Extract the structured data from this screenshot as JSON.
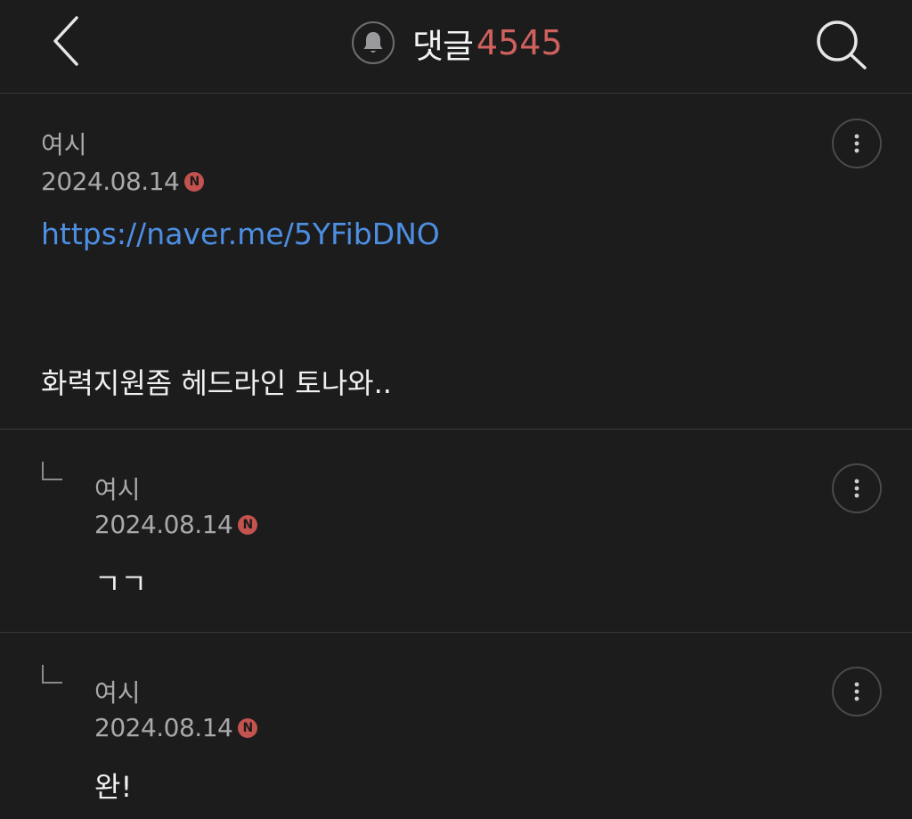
{
  "header": {
    "back_icon": "chevron-left-icon",
    "bell_icon": "bell-icon",
    "title": "댓글",
    "count": "4545",
    "search_icon": "search-icon",
    "accent_color": "#d0615d"
  },
  "comments": [
    {
      "author": "여시",
      "date": "2024.08.14",
      "new_badge": "N",
      "link": "https://naver.me/5YFibDNO",
      "text": "화력지원좀 헤드라인 토나와..",
      "more_icon": "more-vertical-icon"
    },
    {
      "author": "여시",
      "date": "2024.08.14",
      "new_badge": "N",
      "text": "ㄱㄱ",
      "reply_icon": "reply-arrow-icon",
      "more_icon": "more-vertical-icon"
    },
    {
      "author": "여시",
      "date": "2024.08.14",
      "new_badge": "N",
      "text": "완!",
      "reply_icon": "reply-arrow-icon",
      "more_icon": "more-vertical-icon"
    }
  ],
  "colors": {
    "background": "#1c1c1d",
    "link": "#4d8fe2",
    "badge": "#c4534f"
  }
}
